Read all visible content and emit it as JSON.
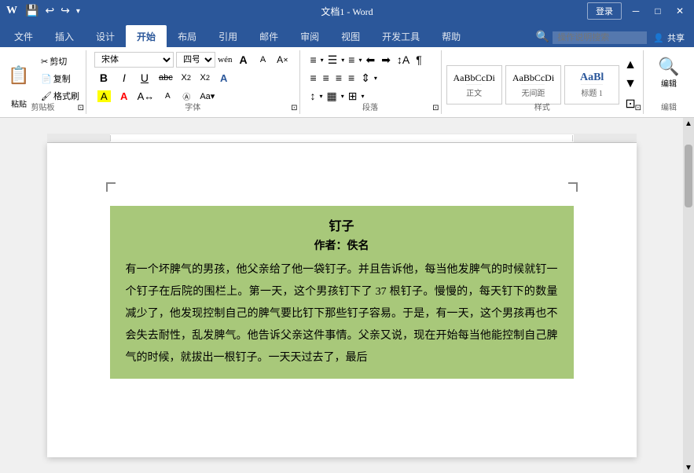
{
  "titleBar": {
    "title": "文档1 - Word",
    "loginBtn": "登录",
    "quickAccess": [
      "↩",
      "↪",
      "💾"
    ]
  },
  "ribbonTabs": {
    "tabs": [
      "文件",
      "插入",
      "设计",
      "开始",
      "布局",
      "引用",
      "邮件",
      "审阅",
      "视图",
      "开发工具",
      "帮助"
    ],
    "activeTab": "开始",
    "searchPlaceholder": "操作说明搜索",
    "shareBtn": "共享"
  },
  "ribbon": {
    "clipboard": {
      "label": "剪贴板",
      "pasteIcon": "📋",
      "buttons": [
        "剪切",
        "复制",
        "格式刷"
      ]
    },
    "font": {
      "label": "字体",
      "fontName": "宋体",
      "fontSize": "四号",
      "width": "wén",
      "buttons": {
        "bold": "B",
        "italic": "I",
        "underline": "U",
        "strikethrough": "abc",
        "sub": "X₂",
        "sup": "X²",
        "clear": "A",
        "colorA": "A",
        "highlight": "A",
        "bigA": "A",
        "smallA": "a",
        "shrink": "A",
        "grow": "A"
      }
    },
    "paragraph": {
      "label": "段落",
      "listBtns": [
        "≡",
        "≡",
        "≡",
        "≡",
        "≡",
        "≡"
      ],
      "alignBtns": [
        "≡",
        "≡",
        "≡",
        "≡"
      ],
      "indentBtns": [
        "⬅",
        "➡"
      ],
      "sortBtn": "↕",
      "shadeBtn": "▦",
      "borderBtn": "⊞"
    },
    "styles": {
      "label": "样式",
      "items": [
        {
          "name": "正文",
          "label": "AaBbCcDi"
        },
        {
          "name": "无间距",
          "label": "AaBbCcDi"
        },
        {
          "name": "标题 1",
          "label": "AaBl"
        }
      ]
    },
    "edit": {
      "label": "编辑",
      "icon": "🔍"
    }
  },
  "document": {
    "title": "钉子",
    "author": "作者：佚名",
    "body": "有一个坏脾气的男孩，他父亲给了他一袋钉子。并且告诉他，每当他发脾气的时候就钉一个钉子在后院的围栏上。第一天，这个男孩钉下了 37 根钉子。慢慢的，每天钉下的数量减少了，他发现控制自己的脾气要比钉下那些钉子容易。于是，有一天，这个男孩再也不会失去耐性，乱发脾气。他告诉父亲这件事情。父亲又说，现在开始每当他能控制自己脾气的时候，就拔出一根钉子。一天天过去了，最后"
  },
  "styleItems": {
    "normal": {
      "label": "AaBbCcDi",
      "name": "正文"
    },
    "noSpace": {
      "label": "AaBbCcDi",
      "name": "无间距"
    },
    "heading1": {
      "label": "AaBl",
      "name": "标题 1"
    }
  }
}
